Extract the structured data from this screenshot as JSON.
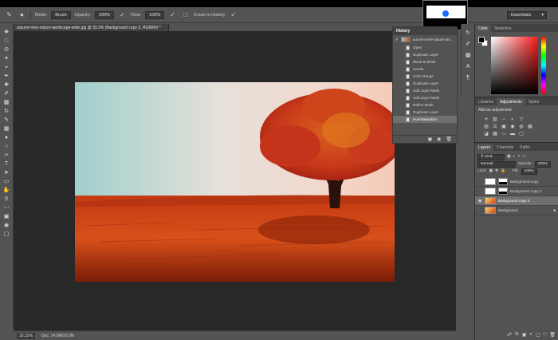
{
  "options_bar": {
    "mode_label": "Mode:",
    "mode_value": "Brush",
    "opacity_label": "Opacity:",
    "opacity_value": "100%",
    "flow_label": "Flow:",
    "flow_value": "100%",
    "erase_to_history": "Erase to History",
    "workspace": "Essentials"
  },
  "document": {
    "tab_title": "autumn-tree-nature-landscape-wide.jpg @ 33.3% (Background copy 3, RGB/8#) *",
    "zoom": "33.33%",
    "doc_info": "Doc: 14.0M/30.0M"
  },
  "history": {
    "title": "History",
    "snapshot": "autumn-tree-nature-lan...",
    "items": [
      "Open",
      "Duplicate Layer",
      "Black & White",
      "Levels",
      "Color Range",
      "Duplicate Layer",
      "Add Layer Mask",
      "Add Layer Mask",
      "Refine Mask",
      "Duplicate Layer",
      "Hue/Saturation"
    ],
    "active_index": 10
  },
  "color_panel": {
    "tabs": [
      "Color",
      "Swatches"
    ],
    "fg": "#000000",
    "bg": "#ffffff"
  },
  "adjustments_panel": {
    "tabs": [
      "Libraries",
      "Adjustments",
      "Styles"
    ],
    "add_label": "Add an adjustment"
  },
  "layers_panel": {
    "tabs": [
      "Layers",
      "Channels",
      "Paths"
    ],
    "filter": "Kind",
    "blend_mode": "Normal",
    "opacity_label": "Opacity:",
    "opacity_value": "100%",
    "lock_label": "Lock:",
    "fill_label": "Fill:",
    "fill_value": "100%",
    "layers": [
      {
        "name": "Background copy",
        "thumb": "mask",
        "visible": false,
        "selected": false
      },
      {
        "name": "Background copy 2",
        "thumb": "mask",
        "visible": false,
        "selected": false
      },
      {
        "name": "Background copy 3",
        "thumb": "orange",
        "visible": true,
        "selected": true
      },
      {
        "name": "Background",
        "thumb": "orange",
        "visible": false,
        "selected": false
      }
    ]
  },
  "colors": {
    "app_bg": "#535353",
    "canvas_bg": "#282828",
    "panel_header": "#424242",
    "selection": "#6f6f6f"
  }
}
